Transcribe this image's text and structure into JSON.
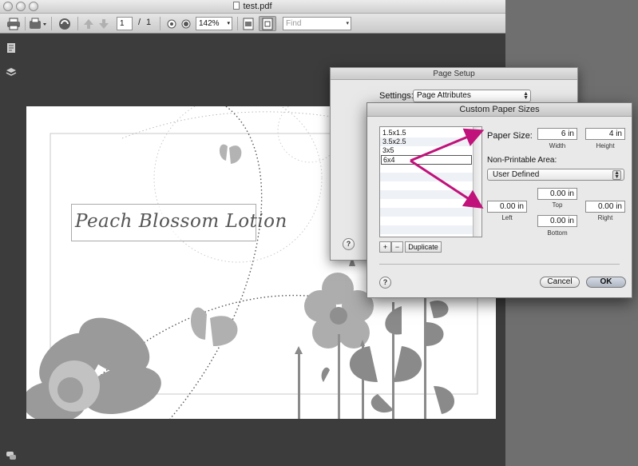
{
  "window": {
    "title": "test.pdf"
  },
  "toolbar": {
    "page_number": "1",
    "page_separator": "/",
    "page_count": "1",
    "zoom": "142%",
    "find_placeholder": "Find",
    "icons": [
      "printer-icon",
      "dropdown-arrow-icon",
      "share-icon",
      "previous-page-icon",
      "next-page-icon",
      "zoom-out-icon",
      "zoom-in-icon",
      "fit-page-icon",
      "actual-size-icon"
    ]
  },
  "sidebar": {
    "icons": [
      "document-icon",
      "layers-icon",
      "comments-icon"
    ]
  },
  "pdf_page": {
    "label_text": "Peach Blossom Lotion"
  },
  "page_setup": {
    "title": "Page Setup",
    "settings_label": "Settings:",
    "settings_value": "Page Attributes",
    "help": "?"
  },
  "custom_paper": {
    "title": "Custom Paper Sizes",
    "list": [
      "1.5x1.5",
      "3.5x2.5",
      "3x5"
    ],
    "editing_item": "6x4",
    "add_label": "+",
    "remove_label": "−",
    "duplicate_label": "Duplicate",
    "paper_size_label": "Paper Size:",
    "width_value": "6 in",
    "width_label": "Width",
    "height_value": "4 in",
    "height_label": "Height",
    "non_printable_label": "Non-Printable Area:",
    "non_printable_value": "User Defined",
    "top_value": "0.00 in",
    "top_label": "Top",
    "left_value": "0.00 in",
    "left_label": "Left",
    "right_value": "0.00 in",
    "right_label": "Right",
    "bottom_value": "0.00 in",
    "bottom_label": "Bottom",
    "help": "?",
    "cancel_label": "Cancel",
    "ok_label": "OK"
  },
  "colors": {
    "annotation_arrow": "#c0127a",
    "workspace": "#3c3c3c"
  }
}
